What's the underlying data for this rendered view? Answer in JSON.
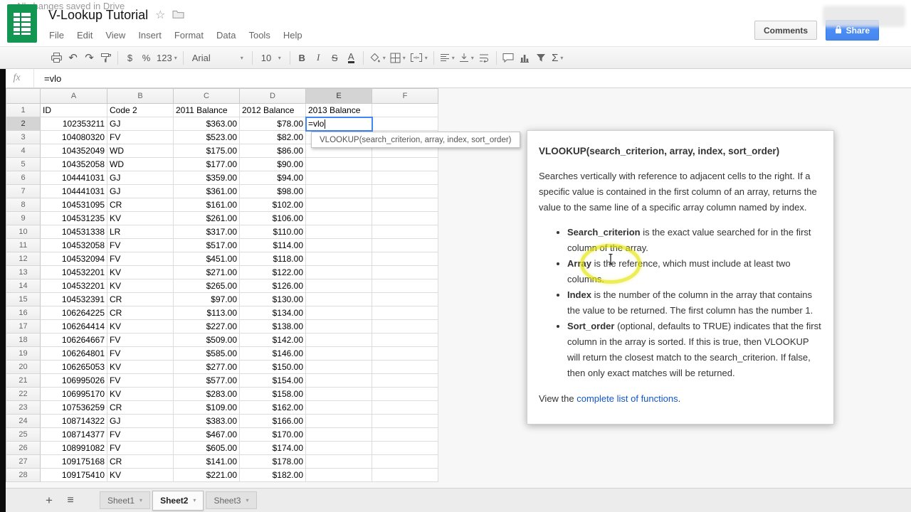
{
  "app": {
    "title": "V-Lookup Tutorial",
    "menus": [
      "File",
      "Edit",
      "View",
      "Insert",
      "Format",
      "Data",
      "Tools",
      "Help"
    ],
    "saved_status": "All changes saved in Drive",
    "comments_label": "Comments",
    "share_label": "Share"
  },
  "colors": {
    "brand_green": "#129652",
    "share_blue": "#4d90fe",
    "selection_blue": "#4285f4",
    "highlight_yellow": "#e4e400",
    "link_blue": "#1155cc"
  },
  "toolbar": {
    "undo": "↶",
    "redo": "↷",
    "currency": "$",
    "percent": "%",
    "more_formats": "123",
    "font": "Arial",
    "size": "10",
    "bold": "B",
    "italic": "I",
    "strike": "S",
    "text_color": "A",
    "sigma": "Σ",
    "caret": "▾",
    "star": "☆"
  },
  "formula_bar": {
    "fx": "fx",
    "value": "=vlo"
  },
  "formula_hint": {
    "text": "VLOOKUP(search_criterion, array, index, sort_order)"
  },
  "grid": {
    "col_letters": [
      "A",
      "B",
      "C",
      "D",
      "E",
      "F"
    ],
    "header_labels": [
      "ID",
      "Code 2",
      "2011 Balance",
      "2012 Balance",
      "2013 Balance",
      ""
    ],
    "active_col": "E",
    "active_row": 2,
    "active_cell_value": "=vlo",
    "row_start": 2,
    "rows": [
      [
        "102353211",
        "GJ",
        "$363.00",
        "$78.00"
      ],
      [
        "104080320",
        "FV",
        "$523.00",
        "$82.00"
      ],
      [
        "104352049",
        "WD",
        "$175.00",
        "$86.00"
      ],
      [
        "104352058",
        "WD",
        "$177.00",
        "$90.00"
      ],
      [
        "104441031",
        "GJ",
        "$359.00",
        "$94.00"
      ],
      [
        "104441031",
        "GJ",
        "$361.00",
        "$98.00"
      ],
      [
        "104531095",
        "CR",
        "$161.00",
        "$102.00"
      ],
      [
        "104531235",
        "KV",
        "$261.00",
        "$106.00"
      ],
      [
        "104531338",
        "LR",
        "$317.00",
        "$110.00"
      ],
      [
        "104532058",
        "FV",
        "$517.00",
        "$114.00"
      ],
      [
        "104532094",
        "FV",
        "$451.00",
        "$118.00"
      ],
      [
        "104532201",
        "KV",
        "$271.00",
        "$122.00"
      ],
      [
        "104532201",
        "KV",
        "$265.00",
        "$126.00"
      ],
      [
        "104532391",
        "CR",
        "$97.00",
        "$130.00"
      ],
      [
        "106264225",
        "CR",
        "$113.00",
        "$134.00"
      ],
      [
        "106264414",
        "KV",
        "$227.00",
        "$138.00"
      ],
      [
        "106264667",
        "FV",
        "$509.00",
        "$142.00"
      ],
      [
        "106264801",
        "FV",
        "$585.00",
        "$146.00"
      ],
      [
        "106265053",
        "KV",
        "$277.00",
        "$150.00"
      ],
      [
        "106995026",
        "FV",
        "$577.00",
        "$154.00"
      ],
      [
        "106995170",
        "KV",
        "$283.00",
        "$158.00"
      ],
      [
        "107536259",
        "CR",
        "$109.00",
        "$162.00"
      ],
      [
        "108714322",
        "GJ",
        "$383.00",
        "$166.00"
      ],
      [
        "108714377",
        "FV",
        "$467.00",
        "$170.00"
      ],
      [
        "108991082",
        "FV",
        "$605.00",
        "$174.00"
      ],
      [
        "109175168",
        "CR",
        "$141.00",
        "$178.00"
      ],
      [
        "109175410",
        "KV",
        "$221.00",
        "$182.00"
      ]
    ]
  },
  "help_card": {
    "title": "VLOOKUP(search_criterion, array, index, sort_order)",
    "description": "Searches vertically with reference to adjacent cells to the right. If a specific value is contained in the first column of an array, returns the value to the same line of a specific array column named by index.",
    "bullets": [
      {
        "term": "Search_criterion",
        "rest": " is the exact value searched for in the first column of the array."
      },
      {
        "term": "Array",
        "rest": " is the reference, which must include at least two columns."
      },
      {
        "term": "Index",
        "rest": " is the number of the column in the array that contains the value to be returned. The first column has the number 1."
      },
      {
        "term": "Sort_order",
        "rest": " (optional, defaults to TRUE) indicates that the first column in the array is sorted. If this is true, then VLOOKUP will return the closest match to the search_criterion. If false, then only exact matches will be returned."
      }
    ],
    "footer_prefix": "View the ",
    "footer_link": "complete list of functions",
    "footer_suffix": "."
  },
  "sheet_tabs": {
    "add": "+",
    "all_sheets": "≡",
    "caret": "▾",
    "active_index": 1,
    "tabs": [
      "Sheet1",
      "Sheet2",
      "Sheet3"
    ]
  }
}
